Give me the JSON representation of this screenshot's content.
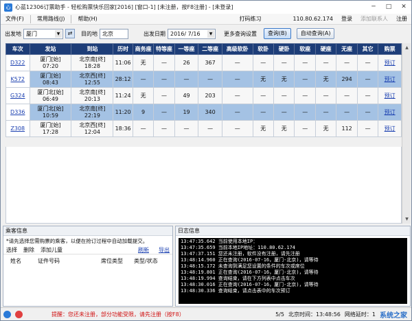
{
  "titlebar": {
    "title": "心蓝12306订票助手 - 轻松购票快乐回家[2016] [窗口-1] [未注册，按F8注册] - [未登录]",
    "minimize": "─",
    "maximize": "□",
    "close": "✕"
  },
  "menubar": {
    "items": [
      "文件(F)",
      "常用路线(J)",
      "帮助(H)"
    ],
    "right": {
      "captcha": "打码练习",
      "ip": "110.80.62.174",
      "login": "登录",
      "contact": "添加联系人",
      "register": "注册"
    }
  },
  "toolbar": {
    "from_label": "出发地",
    "from_value": "厦门",
    "to_label": "目的地",
    "to_value": "北京",
    "date_label": "出发日期",
    "date_value": "2016/ 7/16",
    "more_settings": "更多查询设置",
    "query_button": "查询(B)",
    "auto_query_button": "自动查询(A)"
  },
  "table": {
    "headers": [
      "车次",
      "发站",
      "到站",
      "历时",
      "商务座",
      "特等座",
      "一等座",
      "二等座",
      "高级软卧",
      "软卧",
      "硬卧",
      "软座",
      "硬座",
      "无座",
      "其它",
      "购票"
    ],
    "rows": [
      {
        "code": "D322",
        "from": "厦门[始]",
        "dep": "07:20",
        "to": "北京南[终]",
        "arr": "18:28",
        "dur": "11:06",
        "cells": [
          "无",
          "—",
          "26",
          "367",
          "—",
          "—",
          "—",
          "—",
          "—",
          "—",
          "—"
        ],
        "buy": "预订"
      },
      {
        "code": "K572",
        "from": "厦门[始]",
        "dep": "08:43",
        "to": "北京西[终]",
        "arr": "12:55",
        "dur": "28:12",
        "cells": [
          "—",
          "—",
          "—",
          "—",
          "—",
          "无",
          "无",
          "—",
          "无",
          "294",
          "—"
        ],
        "buy": "预订"
      },
      {
        "code": "G324",
        "from": "厦门北[始]",
        "dep": "06:49",
        "to": "北京南[终]",
        "arr": "20:13",
        "dur": "11:24",
        "cells": [
          "无",
          "—",
          "49",
          "203",
          "—",
          "—",
          "—",
          "—",
          "—",
          "—",
          "—"
        ],
        "buy": "预订"
      },
      {
        "code": "D336",
        "from": "厦门北[始]",
        "dep": "10:59",
        "to": "北京南[终]",
        "arr": "22:19",
        "dur": "11:20",
        "cells": [
          "9",
          "—",
          "19",
          "340",
          "—",
          "—",
          "—",
          "—",
          "—",
          "—",
          "—"
        ],
        "buy": "预订"
      },
      {
        "code": "Z308",
        "from": "厦门[始]",
        "dep": "17:28",
        "to": "北京西[终]",
        "arr": "12:04",
        "dur": "18:36",
        "cells": [
          "—",
          "—",
          "—",
          "—",
          "—",
          "无",
          "无",
          "—",
          "无",
          "112",
          "—"
        ],
        "buy": "预订"
      }
    ]
  },
  "passengers": {
    "title": "乘客信息",
    "hint": "*请先选择您需购票的乘客，以便在抢订过程中自动加载提交。",
    "tabs": [
      "选择",
      "删除",
      "添加儿童"
    ],
    "links": [
      "刷新",
      "导出"
    ],
    "columns": [
      "姓名",
      "证件号码",
      "席位类型",
      "类型/状态"
    ]
  },
  "log": {
    "title": "日志信息",
    "lines": [
      "13:47:35.642 当前使用本地IP：",
      "13:47:35.659 当前本地IP地址：110.80.62.174",
      "13:47:37.151 您还未注册，软件没有注册，请先注册",
      "13:48:14.960 正在查询(2016-07-16，厦门-北京)，请等待",
      "13:48:15.172 未查询到满足您设置的条件的车次或席位",
      "13:48:19.801 正在查询(2016-07-16，厦门-北京)，请等待",
      "13:48:19.994 查询结束，请在下方列表中点击车次",
      "13:48:30.016 正在查询(2016-07-16，厦门-北京)，请等待",
      "13:48:30.336 查询结束，请点击表中的车次预订"
    ]
  },
  "statusbar": {
    "warning": "提醒：您还未注册，部分功能受限，请先注册（按F8）",
    "page": "5/5",
    "time_label": "北京时间：13:48:56",
    "network": "网络延时：1",
    "watermark": "系统之家"
  },
  "colors": {
    "header_bg": "#1d3d78",
    "row_highlight": "#a4c2e4",
    "link": "#1a3fb0",
    "warning": "#d01010"
  }
}
